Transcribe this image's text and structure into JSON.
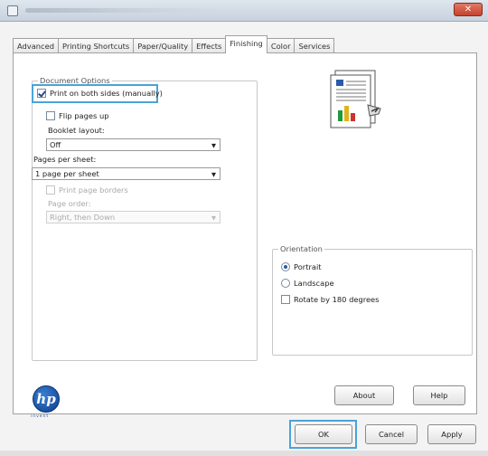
{
  "window": {
    "close_icon": "close-icon",
    "close_glyph": "✕"
  },
  "tabs": [
    {
      "label": "Advanced"
    },
    {
      "label": "Printing Shortcuts"
    },
    {
      "label": "Paper/Quality"
    },
    {
      "label": "Effects"
    },
    {
      "label": "Finishing",
      "active": true
    },
    {
      "label": "Color"
    },
    {
      "label": "Services"
    }
  ],
  "document_options": {
    "title": "Document Options",
    "print_both_sides": {
      "label": "Print on both sides (manually)",
      "checked": true
    },
    "flip_pages_up": {
      "label": "Flip pages up",
      "checked": false
    },
    "booklet_layout": {
      "label": "Booklet layout:",
      "value": "Off"
    },
    "pages_per_sheet": {
      "label": "Pages per sheet:",
      "value": "1 page per sheet"
    },
    "print_page_borders": {
      "label": "Print page borders",
      "checked": false,
      "disabled": true
    },
    "page_order": {
      "label": "Page order:",
      "value": "Right, then Down",
      "disabled": true
    }
  },
  "orientation": {
    "title": "Orientation",
    "portrait": {
      "label": "Portrait",
      "selected": true
    },
    "landscape": {
      "label": "Landscape",
      "selected": false
    },
    "rotate": {
      "label": "Rotate by 180 degrees",
      "checked": false
    }
  },
  "buttons": {
    "about": "About",
    "help": "Help",
    "ok": "OK",
    "cancel": "Cancel",
    "apply": "Apply"
  },
  "logo": {
    "text": "hp",
    "tagline": "invent"
  },
  "colors": {
    "highlight": "#4aa3d8",
    "hp_blue": "#0b3e8f"
  }
}
